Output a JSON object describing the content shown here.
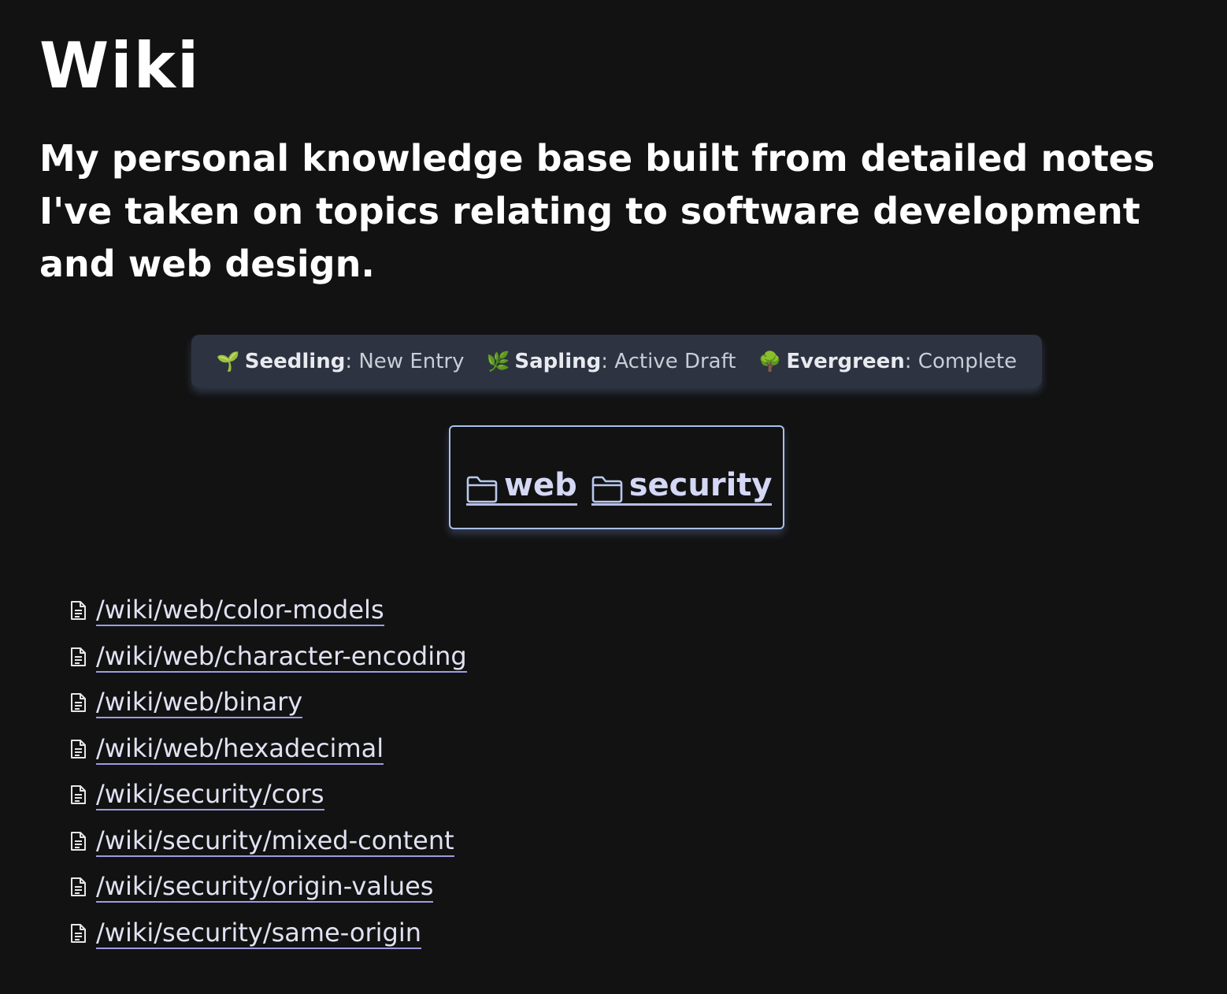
{
  "page": {
    "title": "Wiki",
    "subtitle": "My personal knowledge base built from detailed notes I've taken on topics relating to software development and web design."
  },
  "legend": {
    "items": [
      {
        "icon": "seedling-icon",
        "glyph": "🌱",
        "name": "Seedling",
        "sep": ":",
        "desc": " New Entry"
      },
      {
        "icon": "sapling-icon",
        "glyph": "🌿",
        "name": "Sapling",
        "sep": ":",
        "desc": " Active Draft"
      },
      {
        "icon": "evergreen-icon",
        "glyph": "🌳",
        "name": "Evergreen",
        "sep": ":",
        "desc": " Complete"
      }
    ]
  },
  "folders": [
    {
      "label": "web",
      "icon": "folder-icon"
    },
    {
      "label": "security",
      "icon": "folder-icon"
    }
  ],
  "files": [
    {
      "path": "/wiki/web/color-models",
      "icon": "document-icon"
    },
    {
      "path": "/wiki/web/character-encoding",
      "icon": "document-icon"
    },
    {
      "path": "/wiki/web/binary",
      "icon": "document-icon"
    },
    {
      "path": "/wiki/web/hexadecimal",
      "icon": "document-icon"
    },
    {
      "path": "/wiki/security/cors",
      "icon": "document-icon"
    },
    {
      "path": "/wiki/security/mixed-content",
      "icon": "document-icon"
    },
    {
      "path": "/wiki/security/origin-values",
      "icon": "document-icon"
    },
    {
      "path": "/wiki/security/same-origin",
      "icon": "document-icon"
    }
  ],
  "colors": {
    "background": "#121212",
    "legend_bg": "#2d3341",
    "folder_border": "#a9c0e8",
    "link_underline": "#9d9ce2"
  }
}
